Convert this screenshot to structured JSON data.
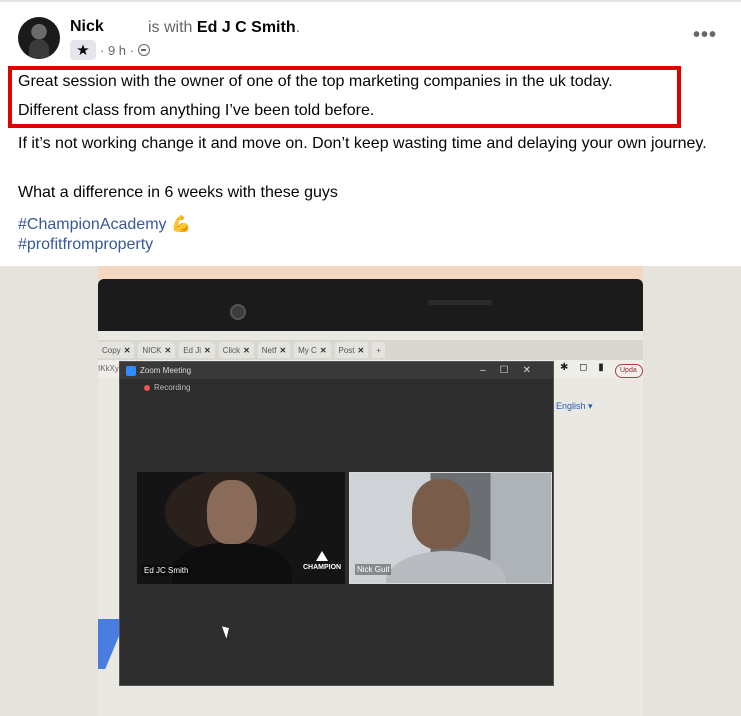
{
  "post": {
    "author": "Nick",
    "with_prefix": "is with",
    "with_name": "Ed J C Smith",
    "with_suffix": ".",
    "time": "· 9 h ·",
    "badge_icon": "star-icon",
    "privacy_icon": "globe-icon",
    "more_label": "•••",
    "lines": [
      "Great session with the owner of one of the top marketing companies in the uk today.",
      "Different class from anything I’ve been told before.",
      "If it’s not working change it and move on.  Don’t keep wasting time and delaying your own journey.",
      "What a difference in 6 weeks with these guys"
    ],
    "hashtags": [
      "#ChampionAcademy 💪",
      "#profitfromproperty"
    ],
    "highlight_color": "#e00000",
    "link_color": "#385898"
  },
  "photo": {
    "tabs": [
      "Copy",
      "NICK",
      "Ed Ji",
      "Click",
      "Netf",
      "My C",
      "Post"
    ],
    "new_tab": "+",
    "address": "IKkXynC",
    "update_btn": "Upda",
    "language": "English ▾",
    "zoom": {
      "title": "Zoom Meeting",
      "controls": "–☐✕",
      "recording": "Recording",
      "participant_left": "Ed JC Smith",
      "participant_right": "Nick Guit",
      "logo_text": "CHAMPION"
    }
  }
}
